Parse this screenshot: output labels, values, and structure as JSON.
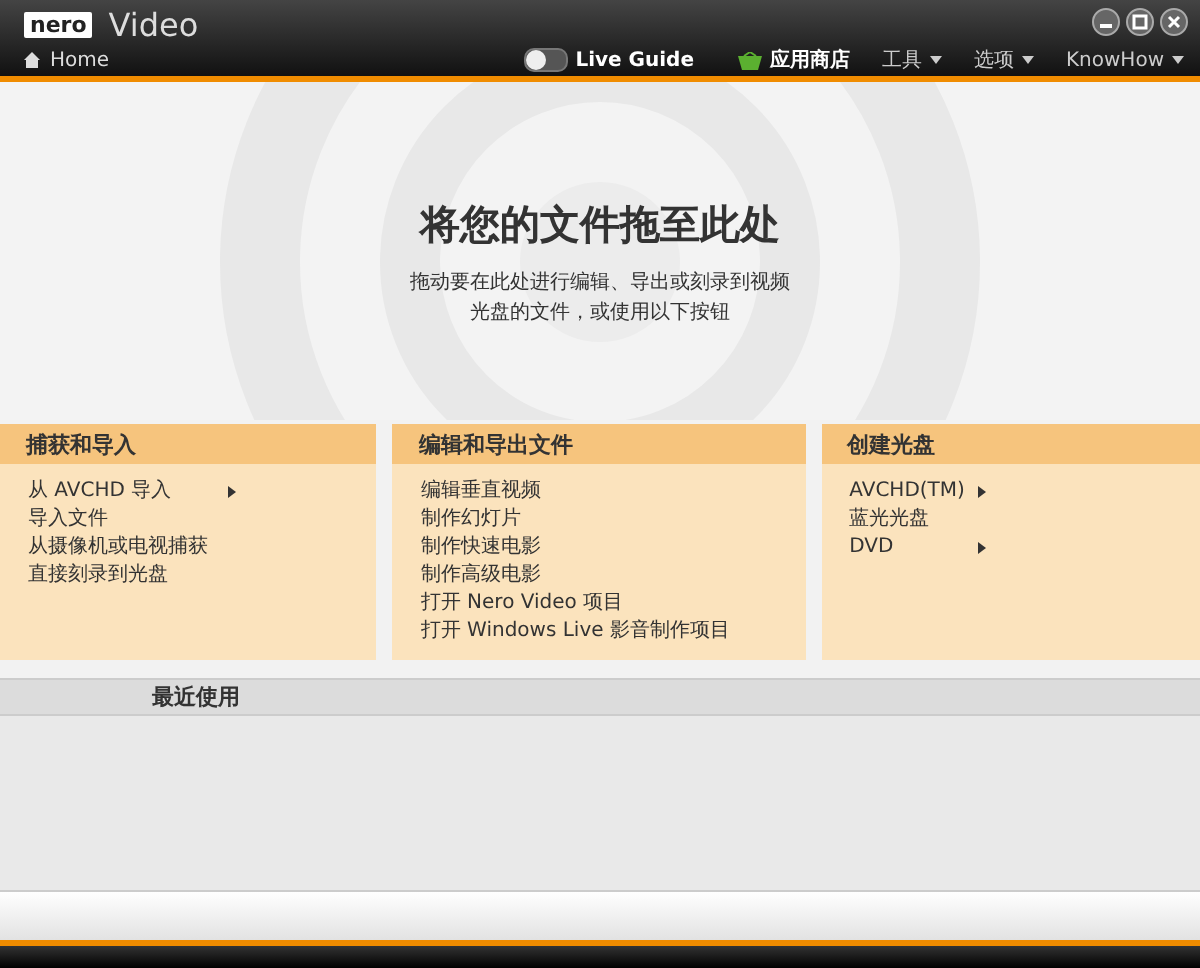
{
  "window": {
    "logo": "nero",
    "title": "Video",
    "breadcrumb": "Home"
  },
  "toolbar": {
    "live_guide": {
      "label": "Live Guide",
      "on": false
    },
    "store": "应用商店",
    "menus": [
      "工具",
      "选项",
      "KnowHow"
    ]
  },
  "drop_zone": {
    "heading": "将您的文件拖至此处",
    "text": "拖动要在此处进行编辑、导出或刻录到视频光盘的文件，或使用以下按钮"
  },
  "panels": [
    {
      "title": "捕获和导入",
      "items": [
        {
          "label": "从 AVCHD 导入",
          "submenu": true
        },
        {
          "label": "导入文件",
          "submenu": false
        },
        {
          "label": "从摄像机或电视捕获",
          "submenu": false
        },
        {
          "label": "直接刻录到光盘",
          "submenu": false
        }
      ]
    },
    {
      "title": "编辑和导出文件",
      "items": [
        {
          "label": "编辑垂直视频",
          "submenu": false
        },
        {
          "label": "制作幻灯片",
          "submenu": false
        },
        {
          "label": "制作快速电影",
          "submenu": false
        },
        {
          "label": "制作高级电影",
          "submenu": false
        },
        {
          "label": "打开 Nero Video 项目",
          "submenu": false
        },
        {
          "label": "打开 Windows Live 影音制作项目",
          "submenu": false
        }
      ]
    },
    {
      "title": "创建光盘",
      "items": [
        {
          "label": "AVCHD(TM)",
          "submenu": true
        },
        {
          "label": "蓝光光盘",
          "submenu": false
        },
        {
          "label": "DVD",
          "submenu": true
        }
      ]
    }
  ],
  "recent": {
    "title": "最近使用"
  }
}
